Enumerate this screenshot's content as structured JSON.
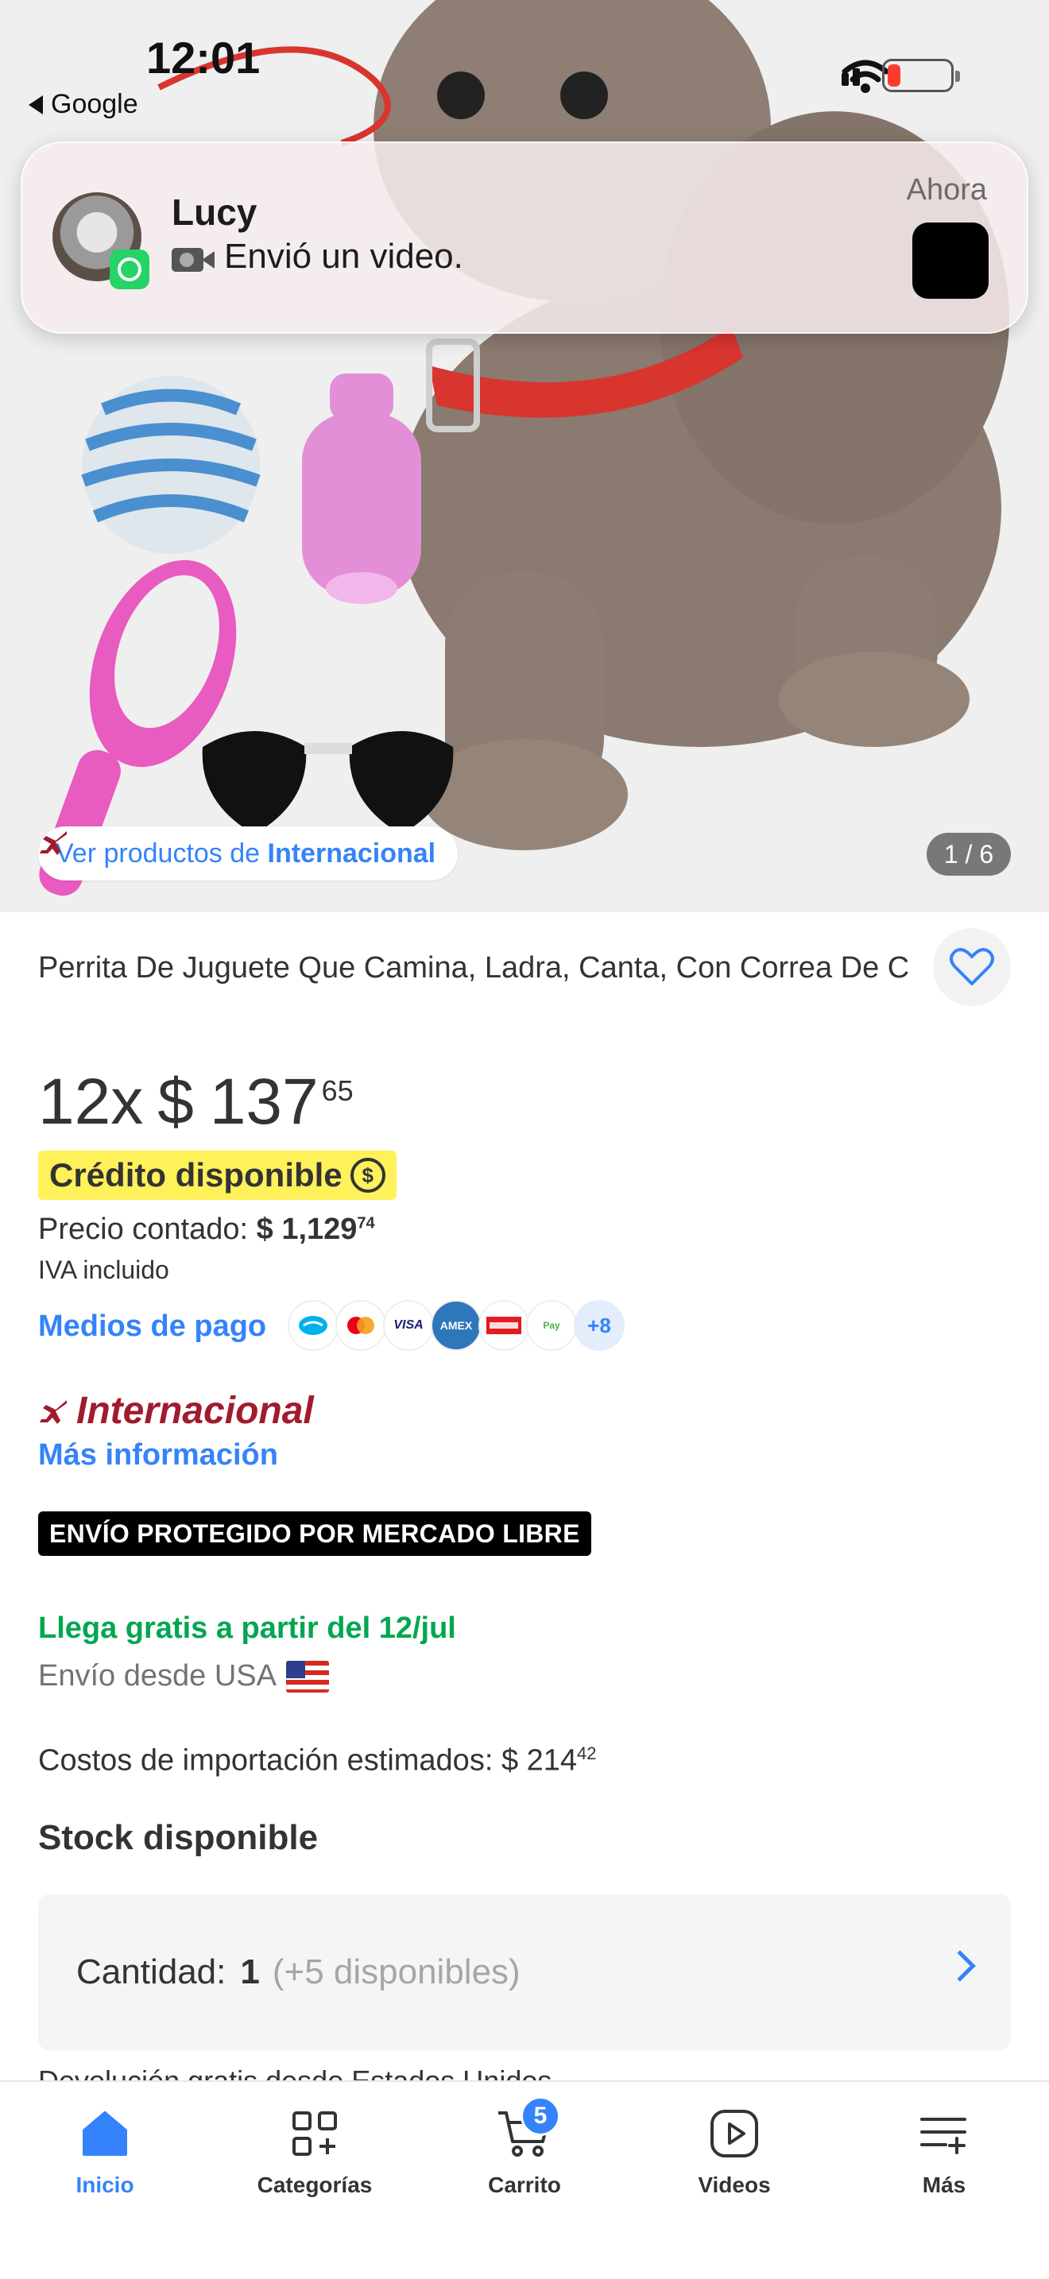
{
  "status_bar": {
    "time": "12:01",
    "back_label": "Google"
  },
  "notification": {
    "sender": "Lucy",
    "message": "Envió un video.",
    "time": "Ahora",
    "app_icon": "whatsapp-icon"
  },
  "gallery": {
    "seller_link_prefix": "Ver productos de ",
    "seller_link_name": "Internacional",
    "counter": "1 / 6"
  },
  "product": {
    "title": "Perrita De Juguete Que Camina, Ladra, Canta, Con Correa De C",
    "installments": "12x",
    "currency": "$",
    "installment_amount": "137",
    "installment_cents": "65",
    "credit_badge": "Crédito disponible",
    "cash_price_label": "Precio contado:",
    "cash_price": "$ 1,129",
    "cash_price_cents": "74",
    "tax_note": "IVA incluido",
    "payment_methods_label": "Medios de pago",
    "payment_methods": [
      "mercado-pago",
      "mastercard",
      "visa",
      "amex",
      "oxxo",
      "paycash"
    ],
    "payment_more": "+8",
    "store_brand": "Internacional",
    "more_info": "Más información",
    "protected_shipping": "ENVÍO PROTEGIDO POR MERCADO LIBRE",
    "arrival": "Llega gratis a partir del 12/jul",
    "ship_from": "Envío desde USA",
    "import_costs_label": "Costos de importación estimados:",
    "import_costs": "$ 214",
    "import_costs_cents": "42",
    "stock": "Stock disponible",
    "quantity_label": "Cantidad:",
    "quantity_value": "1",
    "quantity_available": "(+5 disponibles)",
    "cut_text": "Devolución gratis desde Estados Unidos"
  },
  "bottom_nav": {
    "items": [
      {
        "label": "Inicio",
        "icon": "home-icon",
        "active": true
      },
      {
        "label": "Categorías",
        "icon": "categories-icon"
      },
      {
        "label": "Carrito",
        "icon": "cart-icon",
        "badge": "5"
      },
      {
        "label": "Videos",
        "icon": "play-icon"
      },
      {
        "label": "Más",
        "icon": "more-menu-icon"
      }
    ]
  },
  "colors": {
    "accent_blue": "#3483fa",
    "credit_yellow": "#fff159",
    "success_green": "#00a650",
    "brand_red": "#a11b2e"
  }
}
